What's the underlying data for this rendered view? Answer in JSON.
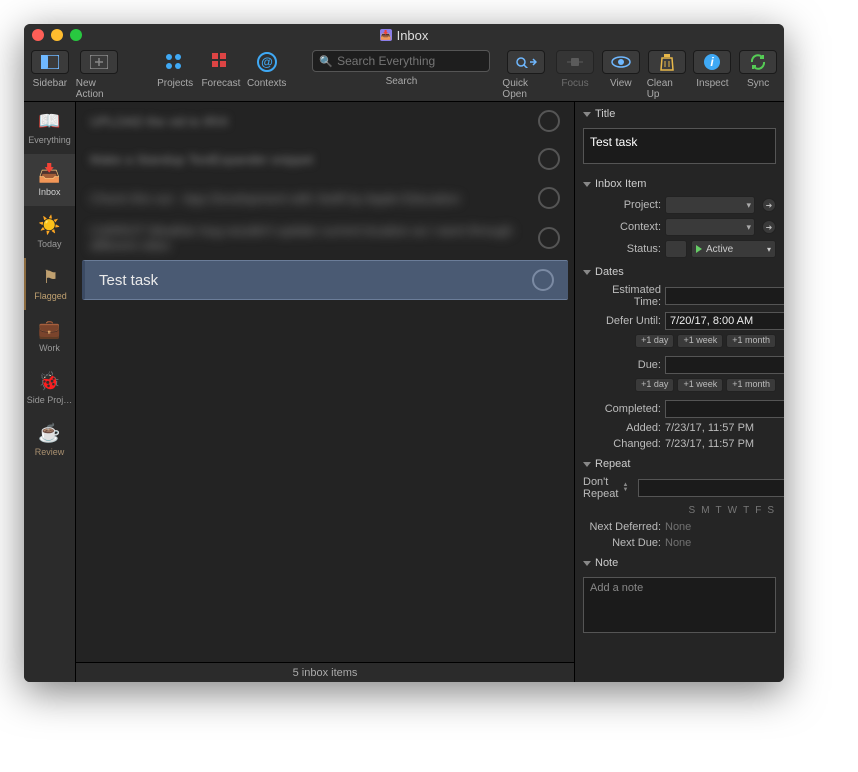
{
  "window": {
    "title": "Inbox"
  },
  "toolbar": {
    "sidebar": "Sidebar",
    "new_action": "New Action",
    "projects": "Projects",
    "forecast": "Forecast",
    "contexts": "Contexts",
    "search": "Search",
    "search_placeholder": "Search Everything",
    "quick_open": "Quick Open",
    "focus": "Focus",
    "view": "View",
    "clean_up": "Clean Up",
    "inspect": "Inspect",
    "sync": "Sync"
  },
  "sidebar": {
    "items": [
      {
        "label": "Everything"
      },
      {
        "label": "Inbox"
      },
      {
        "label": "Today"
      },
      {
        "label": "Flagged"
      },
      {
        "label": "Work"
      },
      {
        "label": "Side Proj…"
      },
      {
        "label": "Review"
      }
    ]
  },
  "tasks": {
    "selected": "Test task"
  },
  "status": {
    "text": "5 inbox items"
  },
  "inspector": {
    "title_hdr": "Title",
    "title_value": "Test task",
    "inbox_hdr": "Inbox Item",
    "project_lbl": "Project:",
    "context_lbl": "Context:",
    "status_lbl": "Status:",
    "status_value": "Active",
    "dates_hdr": "Dates",
    "est_lbl": "Estimated Time:",
    "defer_lbl": "Defer Until:",
    "defer_value": "7/20/17, 8:00 AM",
    "due_lbl": "Due:",
    "completed_lbl": "Completed:",
    "added_lbl": "Added:",
    "added_value": "7/23/17, 11:57 PM",
    "changed_lbl": "Changed:",
    "changed_value": "7/23/17, 11:57 PM",
    "plus_day": "+1 day",
    "plus_week": "+1 week",
    "plus_month": "+1 month",
    "repeat_hdr": "Repeat",
    "repeat_mode": "Don't Repeat",
    "days": [
      "S",
      "M",
      "T",
      "W",
      "T",
      "F",
      "S"
    ],
    "next_def_lbl": "Next Deferred:",
    "next_due_lbl": "Next Due:",
    "none": "None",
    "note_hdr": "Note",
    "note_placeholder": "Add a note"
  }
}
